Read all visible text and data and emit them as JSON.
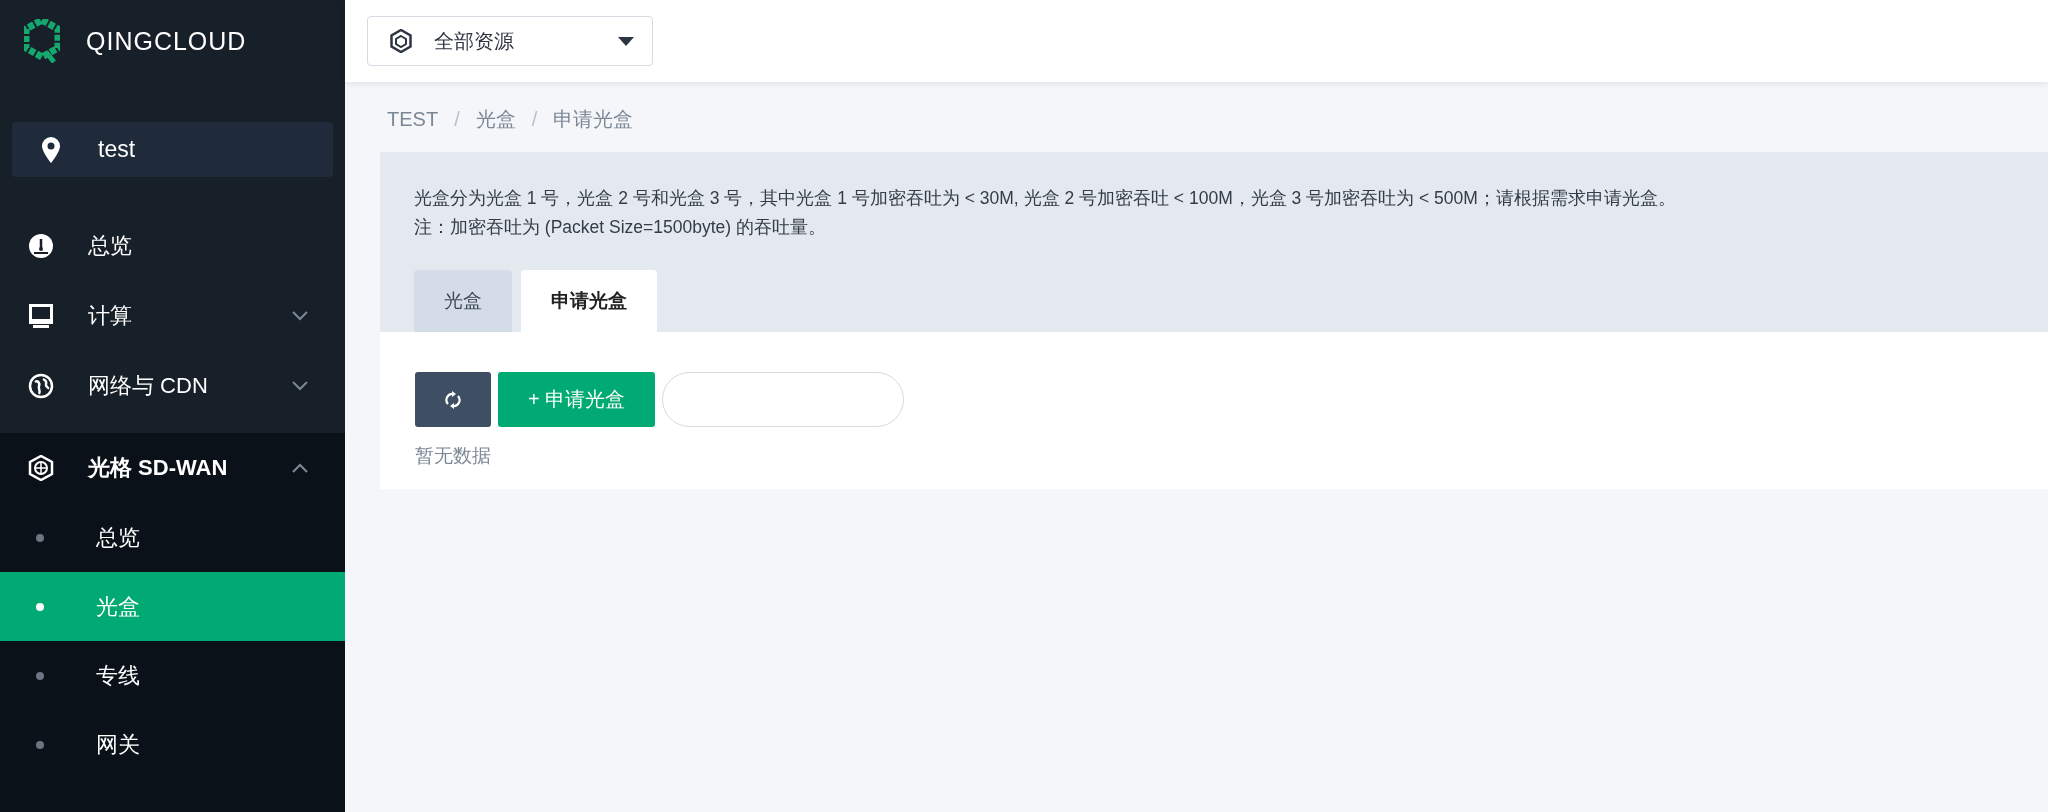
{
  "sidebar": {
    "logo_text": "QINGCLOUD",
    "region": "test",
    "items": [
      {
        "kind": "link",
        "label": "总览"
      },
      {
        "kind": "group",
        "label": "计算",
        "expanded": false
      },
      {
        "kind": "group",
        "label": "网络与 CDN",
        "expanded": false
      },
      {
        "kind": "group",
        "label": "光格 SD-WAN",
        "expanded": true,
        "children": [
          {
            "label": "总览",
            "selected": false
          },
          {
            "label": "光盒",
            "selected": true
          },
          {
            "label": "专线",
            "selected": false
          },
          {
            "label": "网关",
            "selected": false
          }
        ]
      }
    ]
  },
  "topbar": {
    "resource_select": "全部资源"
  },
  "breadcrumb": [
    {
      "kind": "item",
      "label": "TEST"
    },
    {
      "kind": "separator",
      "label": "/"
    },
    {
      "kind": "item",
      "label": "光盒"
    },
    {
      "kind": "separator",
      "label": "/"
    },
    {
      "kind": "current",
      "label": "申请光盒"
    }
  ],
  "notice": [
    "光盒分为光盒 1 号，光盒 2 号和光盒 3 号，其中光盒 1 号加密吞吐为 < 30M, 光盒 2 号加密吞吐 < 100M，光盒 3 号加密吞吐为 < 500M；请根据需求申请光盒。",
    "注：加密吞吐为 (Packet Size=1500byte) 的吞吐量。"
  ],
  "tabs": [
    {
      "label": "光盒",
      "selected": false
    },
    {
      "label": "申请光盒",
      "selected": true
    }
  ],
  "toolbar": {
    "add_button": "+ 申请光盒"
  },
  "empty_text": "暂无数据"
}
